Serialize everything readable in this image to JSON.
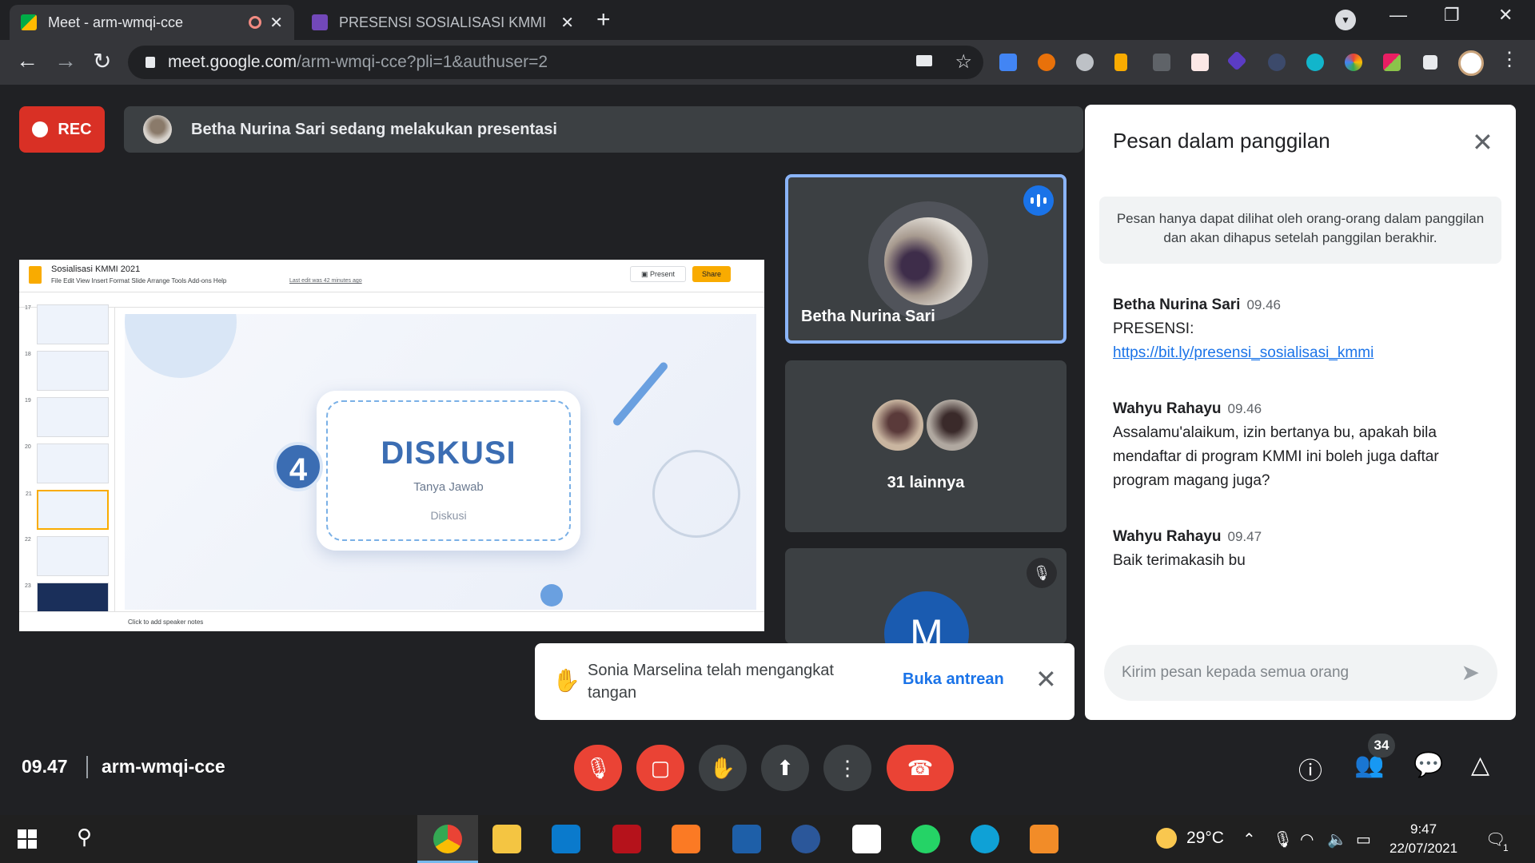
{
  "browser": {
    "tabs": [
      {
        "title": "Meet - arm-wmqi-cce",
        "active": true
      },
      {
        "title": "PRESENSI SOSIALISASI KMMI",
        "active": false
      }
    ],
    "url_host": "meet.google.com",
    "url_path": "/arm-wmqi-cce?pli=1&authuser=2"
  },
  "meet": {
    "rec_label": "REC",
    "presenting_text": "Betha Nurina Sari sedang melakukan presentasi",
    "slide": {
      "doc_title": "Sosialisasi KMMI 2021",
      "menu": "File   Edit   View   Insert   Format   Slide   Arrange   Tools   Add-ons   Help",
      "last_edit": "Last edit was 42 minutes ago",
      "present_label": "Present",
      "share_label": "Share",
      "slide_numbers": [
        "17",
        "18",
        "19",
        "20",
        "21",
        "22",
        "23"
      ],
      "heading": "DISKUSI",
      "subtitle": "Tanya Jawab",
      "subtitle2": "Diskusi",
      "number": "4",
      "notes_placeholder": "Click to add speaker notes"
    },
    "tiles": {
      "main_speaker": "Betha Nurina Sari",
      "others_label": "31 lainnya",
      "third_initial": "M"
    },
    "toast": {
      "message": "Sonia Marselina telah mengangkat tangan",
      "action": "Buka antrean"
    },
    "chat": {
      "title": "Pesan dalam panggilan",
      "notice": "Pesan hanya dapat dilihat oleh orang-orang dalam panggilan dan akan dihapus setelah panggilan berakhir.",
      "messages": [
        {
          "sender": "Betha Nurina Sari",
          "time": "09.46",
          "text": "PRESENSI:",
          "link": "https://bit.ly/presensi_sosialisasi_kmmi"
        },
        {
          "sender": "Wahyu Rahayu",
          "time": "09.46",
          "text": "Assalamu'alaikum, izin bertanya bu, apakah bila mendaftar di program KMMI ini boleh juga daftar program magang juga?"
        },
        {
          "sender": "Wahyu Rahayu",
          "time": "09.47",
          "text": "Baik terimakasih bu"
        }
      ],
      "input_placeholder": "Kirim pesan kepada semua orang"
    },
    "bottom": {
      "time": "09.47",
      "meeting_code": "arm-wmqi-cce",
      "participants_count": "34"
    }
  },
  "taskbar": {
    "temperature": "29°C",
    "time": "9:47",
    "date": "22/07/2021",
    "notifications": "1"
  },
  "colors": {
    "meet_bg": "#202124",
    "accent_blue": "#1a73e8",
    "control_red": "#ea4335",
    "rec_red": "#d93025",
    "tile_bg": "#3c4043"
  }
}
